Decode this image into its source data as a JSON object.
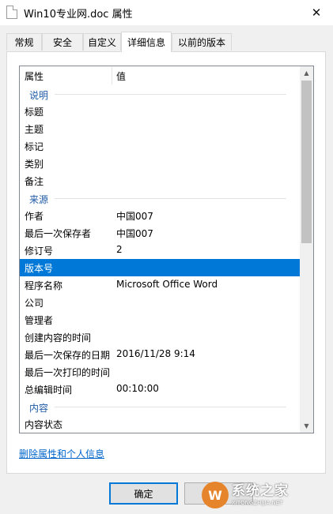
{
  "window": {
    "title": "Win10专业网.doc 属性",
    "close_glyph": "✕"
  },
  "tabs": [
    {
      "label": "常规"
    },
    {
      "label": "安全"
    },
    {
      "label": "自定义"
    },
    {
      "label": "详细信息",
      "active": true
    },
    {
      "label": "以前的版本"
    }
  ],
  "list": {
    "header": {
      "property": "属性",
      "value": "值"
    },
    "groups": {
      "description": "说明",
      "origin": "来源",
      "content": "内容"
    },
    "description_rows": [
      {
        "name": "标题",
        "value": ""
      },
      {
        "name": "主题",
        "value": ""
      },
      {
        "name": "标记",
        "value": ""
      },
      {
        "name": "类别",
        "value": ""
      },
      {
        "name": "备注",
        "value": ""
      }
    ],
    "origin_rows": [
      {
        "name": "作者",
        "value": "中国007"
      },
      {
        "name": "最后一次保存者",
        "value": "中国007"
      },
      {
        "name": "修订号",
        "value": "2"
      },
      {
        "name": "版本号",
        "value": "",
        "selected": true
      },
      {
        "name": "程序名称",
        "value": "Microsoft Office Word"
      },
      {
        "name": "公司",
        "value": ""
      },
      {
        "name": "管理者",
        "value": ""
      },
      {
        "name": "创建内容的时间",
        "value": ""
      },
      {
        "name": "最后一次保存的日期",
        "value": "2016/11/28 9:14"
      },
      {
        "name": "最后一次打印的时间",
        "value": ""
      },
      {
        "name": "总编辑时间",
        "value": "00:10:00"
      }
    ],
    "content_rows": [
      {
        "name": "内容状态",
        "value": ""
      }
    ],
    "scroll_up_glyph": "▲",
    "scroll_down_glyph": "▼"
  },
  "remove_link": "删除属性和个人信息",
  "buttons": {
    "ok": "确定",
    "cancel": "取消"
  },
  "watermark": {
    "logo": "W",
    "text": "系统之家",
    "sub": "XITONGZHIJIA.NET"
  },
  "colors": {
    "selection": "#0078d7",
    "group_text": "#1e5aa6",
    "link": "#0066cc"
  },
  "icons": {
    "document": "document-icon",
    "close": "close-icon",
    "scroll_up": "scroll-up-arrow-icon",
    "scroll_down": "scroll-down-arrow-icon"
  }
}
